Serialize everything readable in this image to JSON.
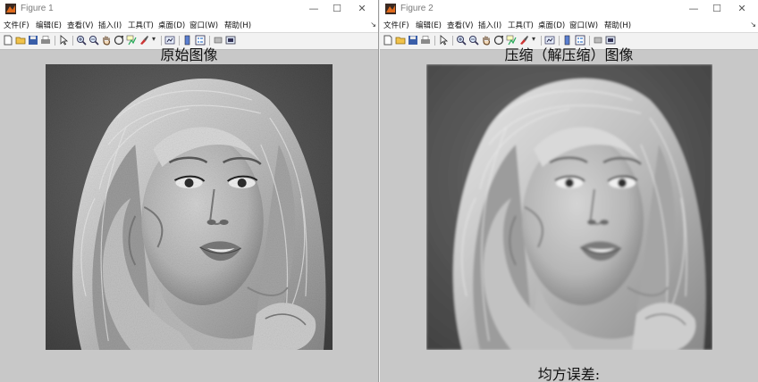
{
  "figures": [
    {
      "window_title": "Figure 1",
      "axes_title": "原始图像",
      "image_alt": "原始图像"
    },
    {
      "window_title": "Figure 2",
      "axes_title": "压缩（解压缩）图像",
      "image_alt": "压缩（解压缩）图像",
      "mse_label": "均方误差:"
    }
  ],
  "menu": [
    "文件(F)",
    "编辑(E)",
    "查看(V)",
    "插入(I)",
    "工具(T)",
    "桌面(D)",
    "窗口(W)",
    "帮助(H)"
  ],
  "window_controls": {
    "minimize": "—",
    "maximize": "☐",
    "close": "✕"
  },
  "menu_more": "↘",
  "toolbar_icons": [
    "new-figure-icon",
    "open-file-icon",
    "save-icon",
    "print-icon",
    "pointer-icon",
    "zoom-in-icon",
    "zoom-out-icon",
    "pan-icon",
    "rotate-3d-icon",
    "data-cursor-icon",
    "brush-icon",
    "link-plot-icon",
    "colorbar-icon",
    "legend-icon",
    "hide-plot-tools-icon",
    "show-plot-tools-icon"
  ],
  "colors": {
    "figure_bg": "#c8c8c8",
    "titlebar_bg": "#ffffff",
    "toolbar_bg": "#f2f2f2"
  }
}
